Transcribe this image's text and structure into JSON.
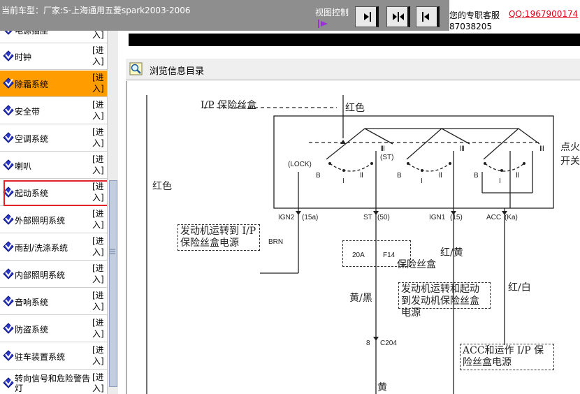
{
  "topbar": {
    "car_label": "当前车型：厂家:S-上海通用五菱spark2003-2006",
    "view_control": "视图控制",
    "service_label": "您的专职客服",
    "qq": "QQ:1967900174",
    "phone": "87038205"
  },
  "sidebar": {
    "items": [
      {
        "label": "电源插座",
        "enter": "[进入]"
      },
      {
        "label": "时钟",
        "enter": "[进入]"
      },
      {
        "label": "除霜系统",
        "enter": "[进入]"
      },
      {
        "label": "安全带",
        "enter": "[进入]"
      },
      {
        "label": "空调系统",
        "enter": "[进入]"
      },
      {
        "label": "喇叭",
        "enter": "[进入]"
      },
      {
        "label": "起动系统",
        "enter": "[进入]"
      },
      {
        "label": "外部照明系统",
        "enter": "[进入]"
      },
      {
        "label": "雨刮/洗涤系统",
        "enter": "[进入]"
      },
      {
        "label": "内部照明系统",
        "enter": "[进入]"
      },
      {
        "label": "音响系统",
        "enter": "[进入]"
      },
      {
        "label": "防盗系统",
        "enter": "[进入]"
      },
      {
        "label": "驻车装置系统",
        "enter": "[进入]"
      },
      {
        "label": "转向信号和危险警告灯",
        "enter": "[进入]"
      }
    ]
  },
  "content": {
    "browse_label": "浏览信息目录"
  },
  "diagram": {
    "ip_fuse_box": "I/P 保险丝盒",
    "red_top": "红色",
    "red_left": "红色",
    "ignition_switch": "点火开关",
    "lock": "(LOCK)",
    "st_paren": "(ST)",
    "b1": "B",
    "i1": "I",
    "ii1": "Ⅱ",
    "iii1": "Ⅲ",
    "b2": "B",
    "i2": "I",
    "ii2": "Ⅱ",
    "iii2": "Ⅲ",
    "b3": "B",
    "i3": "I",
    "ii3": "Ⅱ",
    "iii3": "Ⅲ",
    "ign2": "IGN2",
    "ign2_val": "(15a)",
    "st": "ST",
    "st_val": "(50)",
    "ign1": "IGN1",
    "ign1_val": "(15)",
    "acc": "ACC",
    "acc_val": "(Ka)",
    "box1": "发动机运转到 I/P 保险丝盒电源",
    "brn": "BRN",
    "fuse_amp": "20A",
    "fuse_name": "F14",
    "fuse_box": "保险丝盒",
    "red_yellow": "红/黄",
    "yellow_black": "黄/黑",
    "box2": "发动机运转和起动到发动机保险丝盒电源",
    "red_white": "红/白",
    "connector_pin": "8",
    "connector": "C204",
    "yellow": "黄",
    "box3": "ACC和运作 I/P 保险丝盒电源"
  },
  "colors": {
    "topbar": "#8e8e8e",
    "selected": "#ff9c00",
    "highlight": "#e0232a",
    "qq": "#e0001a"
  }
}
